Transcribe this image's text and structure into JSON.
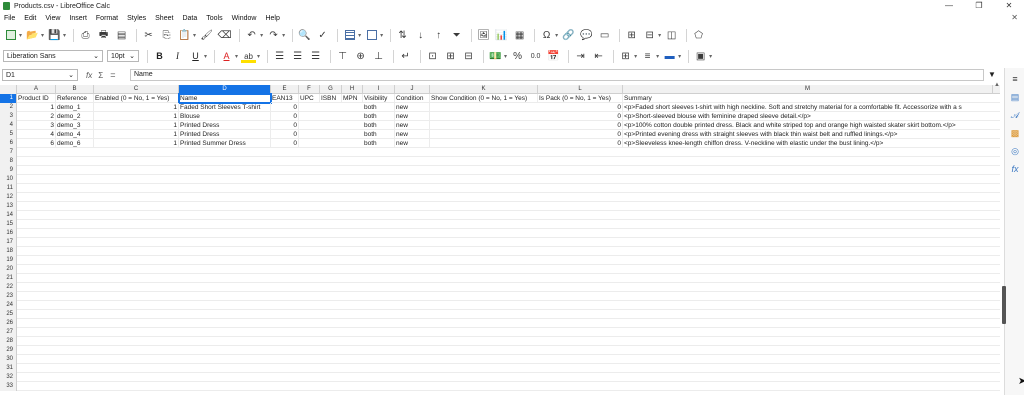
{
  "window": {
    "title": "Products.csv - LibreOffice Calc",
    "minimize": "—",
    "maximize": "❐",
    "close": "✕"
  },
  "menu": [
    "File",
    "Edit",
    "View",
    "Insert",
    "Format",
    "Styles",
    "Sheet",
    "Data",
    "Tools",
    "Window",
    "Help"
  ],
  "close_doc": "✕",
  "format_toolbar": {
    "font_name": "Liberation Sans",
    "font_size": "10pt",
    "bold": "B",
    "italic": "I",
    "underline": "U",
    "font_color": "A",
    "highlight": "ab",
    "percent": "%",
    "decimal": "0.0"
  },
  "formula_bar": {
    "name_box": "D1",
    "fx": "fx",
    "sigma": "Σ",
    "equals": "=",
    "content": "Name"
  },
  "columns": [
    "A",
    "B",
    "C",
    "D",
    "E",
    "F",
    "G",
    "H",
    "I",
    "J",
    "K",
    "L",
    "M"
  ],
  "selected_column": "D",
  "row_numbers": [
    "1",
    "2",
    "3",
    "4",
    "5",
    "6",
    "7",
    "8",
    "9",
    "10",
    "11",
    "12",
    "13",
    "14",
    "15",
    "16",
    "17",
    "18",
    "19",
    "20",
    "21",
    "22",
    "23",
    "24",
    "25",
    "26",
    "27",
    "28",
    "29",
    "30",
    "31",
    "32",
    "33"
  ],
  "headers": [
    "Product ID",
    "Reference",
    "Enabled (0 = No, 1 = Yes)",
    "Name",
    "EAN13",
    "UPC",
    "ISBN",
    "MPN",
    "Visibility",
    "Condition",
    "Show Condition (0 = No, 1 = Yes)",
    "Is Pack (0 = No, 1 = Yes)",
    "Summary"
  ],
  "rows": [
    [
      "1",
      "demo_1",
      "1",
      "Faded Short Sleeves T-shirt",
      "0",
      "",
      "",
      "",
      "both",
      "new",
      "",
      "0",
      "<p>Faded short sleeves t-shirt with high neckline. Soft and stretchy material for a comfortable fit. Accessorize with a s"
    ],
    [
      "2",
      "demo_2",
      "1",
      "Blouse",
      "0",
      "",
      "",
      "",
      "both",
      "new",
      "",
      "0",
      "<p>Short-sleeved blouse with feminine draped sleeve detail.</p>"
    ],
    [
      "3",
      "demo_3",
      "1",
      "Printed Dress",
      "0",
      "",
      "",
      "",
      "both",
      "new",
      "",
      "0",
      "<p>100% cotton double printed dress. Black and white striped top and orange high waisted skater skirt bottom.</p>"
    ],
    [
      "4",
      "demo_4",
      "1",
      "Printed Dress",
      "0",
      "",
      "",
      "",
      "both",
      "new",
      "",
      "0",
      "<p>Printed evening dress with straight sleeves with black thin waist belt and ruffled linings.</p>"
    ],
    [
      "6",
      "demo_6",
      "1",
      "Printed Summer Dress",
      "0",
      "",
      "",
      "",
      "both",
      "new",
      "",
      "0",
      "<p>Sleeveless knee-length chiffon dress. V-neckline with elastic under the bust lining.</p>"
    ]
  ],
  "sidebar_icons": [
    "properties-icon",
    "styles-icon",
    "gallery-icon",
    "navigator-icon",
    "functions-icon"
  ]
}
